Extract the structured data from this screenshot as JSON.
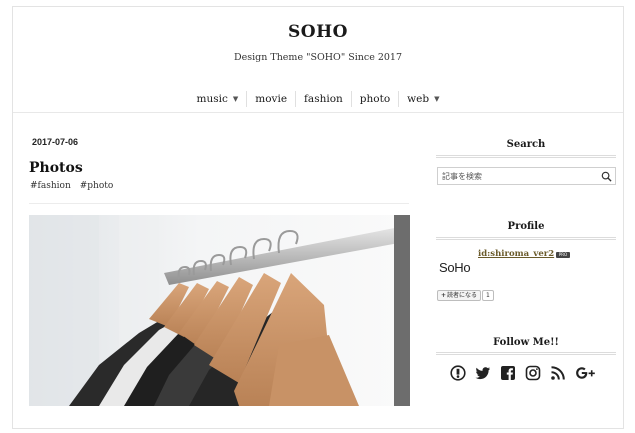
{
  "header": {
    "site_title": "SOHO",
    "site_description": "Design Theme \"SOHO\" Since 2017"
  },
  "nav": {
    "items": [
      {
        "label": "music",
        "has_dropdown": true
      },
      {
        "label": "movie",
        "has_dropdown": false
      },
      {
        "label": "fashion",
        "has_dropdown": false
      },
      {
        "label": "photo",
        "has_dropdown": false
      },
      {
        "label": "web",
        "has_dropdown": true
      }
    ]
  },
  "post": {
    "date": "2017-07-06",
    "title": "Photos",
    "tags": [
      "#fashion",
      "#photo"
    ],
    "image_icon": "clothes-rack-photo"
  },
  "sidebar": {
    "search": {
      "title": "Search",
      "placeholder": "記事を検索",
      "icon": "search-icon"
    },
    "profile": {
      "title": "Profile",
      "user_id": "id:shiroma_ver2",
      "badge": "PRO",
      "logo_text": "SoHo",
      "reader_button": "読者になる",
      "reader_count": "1"
    },
    "follow": {
      "title": "Follow Me!!",
      "icons": [
        "hatena-icon",
        "twitter-icon",
        "facebook-icon",
        "instagram-icon",
        "rss-icon",
        "google-plus-icon"
      ]
    }
  },
  "colors": {
    "text": "#222222",
    "border": "#e3e3e3",
    "link_gold": "#6a5a2a"
  }
}
